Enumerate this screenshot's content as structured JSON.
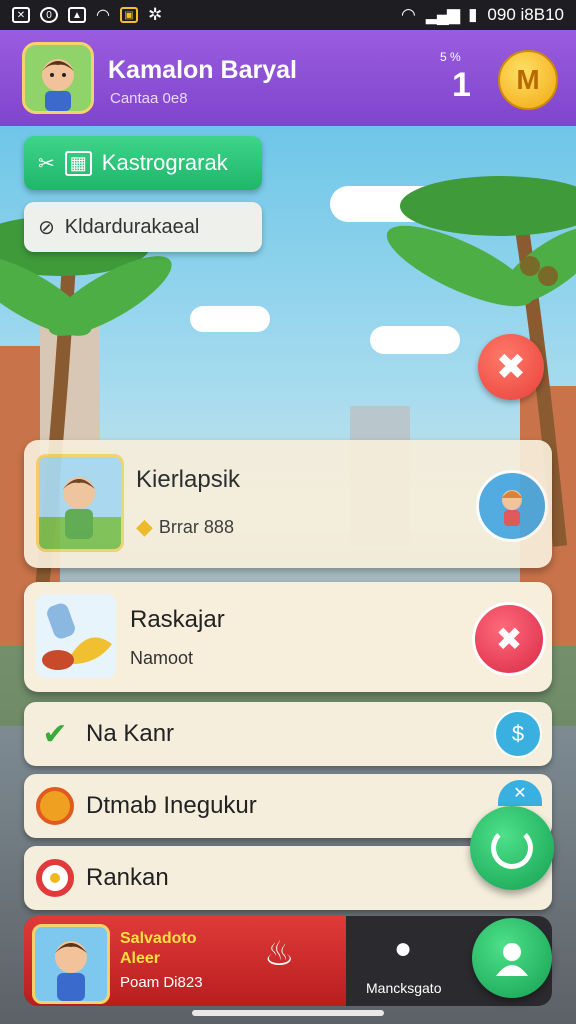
{
  "status_bar": {
    "left_icons": [
      "x-box-icon",
      "circle-icon",
      "box-icon",
      "wifi-icon",
      "notification-icon",
      "wind-icon"
    ],
    "time": "090 i8B10"
  },
  "header": {
    "player_name": "Kamalon Baryal",
    "player_sub": "Cantaa 0e8",
    "counter_small": "5 %",
    "counter_value": "1",
    "coin_letter": "M"
  },
  "menu": {
    "green_pill_label": "Kastrograrak",
    "white_pill_label": "Kldardurakaeal"
  },
  "card_1": {
    "title": "Kierlapsik",
    "subtitle": "Brrar 888"
  },
  "card_2": {
    "title": "Raskajar",
    "subtitle": "Namoot"
  },
  "rows": [
    {
      "label": "Na Kanr",
      "icon": "leaf-icon",
      "right_icon": "dollar-icon"
    },
    {
      "label": "Dtmab Inegukur",
      "icon": "ring-icon",
      "right_icon": "badge-icon"
    },
    {
      "label": "Rankan",
      "icon": "target-icon",
      "right_icon": ""
    }
  ],
  "bottom_bar": {
    "title_line1": "Salvadoto",
    "title_line2": "Aleer",
    "sub": "Poam Di823",
    "right_label": "Mancksgato"
  },
  "colors": {
    "header": "#8b50d8",
    "green": "#26c274",
    "red": "#e8403a",
    "card": "#f7eedb"
  }
}
